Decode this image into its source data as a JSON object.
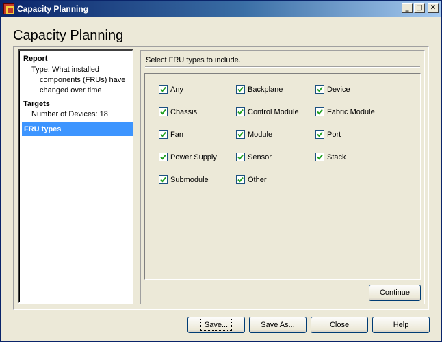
{
  "window": {
    "title": "Capacity Planning",
    "buttons": {
      "minimize": "_",
      "maximize": "□",
      "close": "✕"
    }
  },
  "heading": "Capacity Planning",
  "left_panel": {
    "report_title": "Report",
    "report_type_lines": [
      "Type: What installed",
      "components (FRUs) have",
      "changed over time"
    ],
    "targets_title": "Targets",
    "targets_text": "Number of Devices: 18",
    "selected_item": "FRU types"
  },
  "right_panel": {
    "instruction": "Select FRU types to include.",
    "checkboxes": [
      {
        "label": "Any",
        "checked": true
      },
      {
        "label": "Backplane",
        "checked": true
      },
      {
        "label": "Device",
        "checked": true
      },
      {
        "label": "Chassis",
        "checked": true
      },
      {
        "label": "Control Module",
        "checked": true
      },
      {
        "label": "Fabric Module",
        "checked": true
      },
      {
        "label": "Fan",
        "checked": true
      },
      {
        "label": "Module",
        "checked": true
      },
      {
        "label": "Port",
        "checked": true
      },
      {
        "label": "Power Supply",
        "checked": true
      },
      {
        "label": "Sensor",
        "checked": true
      },
      {
        "label": "Stack",
        "checked": true
      },
      {
        "label": "Submodule",
        "checked": true
      },
      {
        "label": "Other",
        "checked": true
      }
    ],
    "continue_label": "Continue"
  },
  "footer": {
    "save_label": "Save...",
    "save_as_label": "Save As...",
    "close_label": "Close",
    "help_label": "Help"
  },
  "colors": {
    "title_gradient_start": "#0a246a",
    "selection": "#3d95ff",
    "checkmark": "#21a121"
  }
}
